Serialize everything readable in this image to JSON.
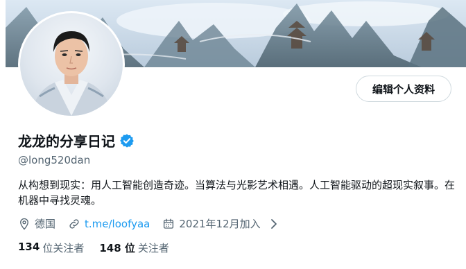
{
  "profile": {
    "display_name": "龙龙的分享日记",
    "handle": "@long520dan",
    "bio": "从构想到现实：用人工智能创造奇迹。当算法与光影艺术相遇。人工智能驱动的超现实叙事。在机器中寻找灵魂。",
    "location": "德国",
    "link": "t.me/loofyaa",
    "joined": "2021年12月加入",
    "edit_label": "编辑个人资料"
  },
  "stats": {
    "following_count": "134",
    "following_label": "位关注者",
    "followers_count": "148 位",
    "followers_label": "关注者"
  },
  "icons": {
    "verified": "verified-badge-icon",
    "location": "location-pin-icon",
    "link": "link-icon",
    "calendar": "calendar-icon",
    "chevron": "chevron-right-icon"
  },
  "colors": {
    "accent": "#1d9bf0",
    "muted": "#536471",
    "text": "#0f1419",
    "border": "#cfd9de"
  }
}
